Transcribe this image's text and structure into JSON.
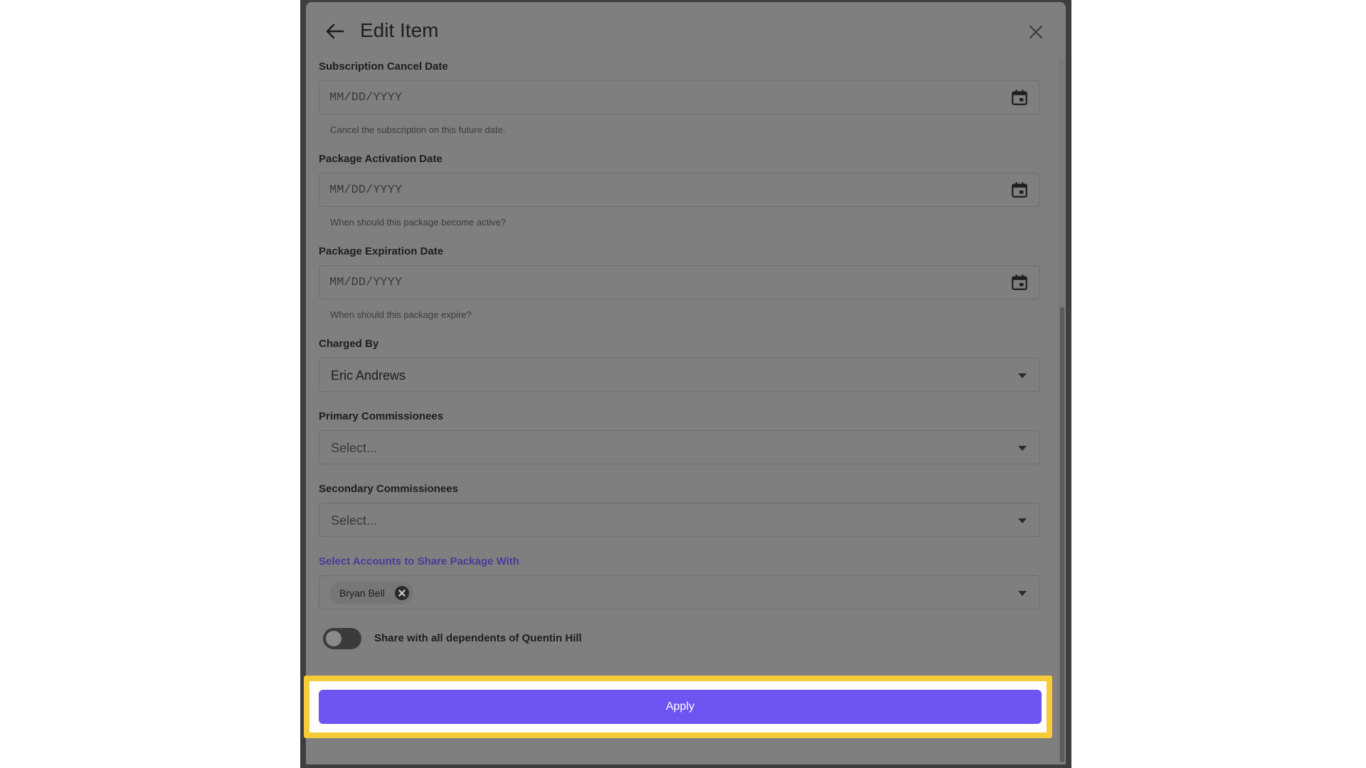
{
  "modal": {
    "title": "Edit Item"
  },
  "fields": {
    "cancel_date": {
      "label": "Subscription Cancel Date",
      "placeholder": "MM/DD/YYYY",
      "helper": "Cancel the subscription on this future date."
    },
    "activation_date": {
      "label": "Package Activation Date",
      "placeholder": "MM/DD/YYYY",
      "helper": "When should this package become active?"
    },
    "expiration_date": {
      "label": "Package Expiration Date",
      "placeholder": "MM/DD/YYYY",
      "helper": "When should this package expire?"
    },
    "charged_by": {
      "label": "Charged By",
      "value": "Eric Andrews"
    },
    "primary_commissionees": {
      "label": "Primary Commissionees",
      "placeholder": "Select..."
    },
    "secondary_commissionees": {
      "label": "Secondary Commissionees",
      "placeholder": "Select..."
    },
    "share_accounts": {
      "label": "Select Accounts to Share Package With",
      "chips": [
        "Bryan Bell"
      ]
    },
    "share_dependents": {
      "label": "Share with all dependents of Quentin Hill",
      "enabled": false
    }
  },
  "actions": {
    "apply_label": "Apply"
  },
  "colors": {
    "primary": "#6e55f2",
    "highlight": "#f6cb3a",
    "accent_label": "#4a3b9a"
  },
  "icons": {
    "back": "arrow-left-icon",
    "close": "close-icon",
    "calendar": "calendar-icon",
    "dropdown": "chevron-down-icon",
    "chip_remove": "remove-chip-icon"
  }
}
